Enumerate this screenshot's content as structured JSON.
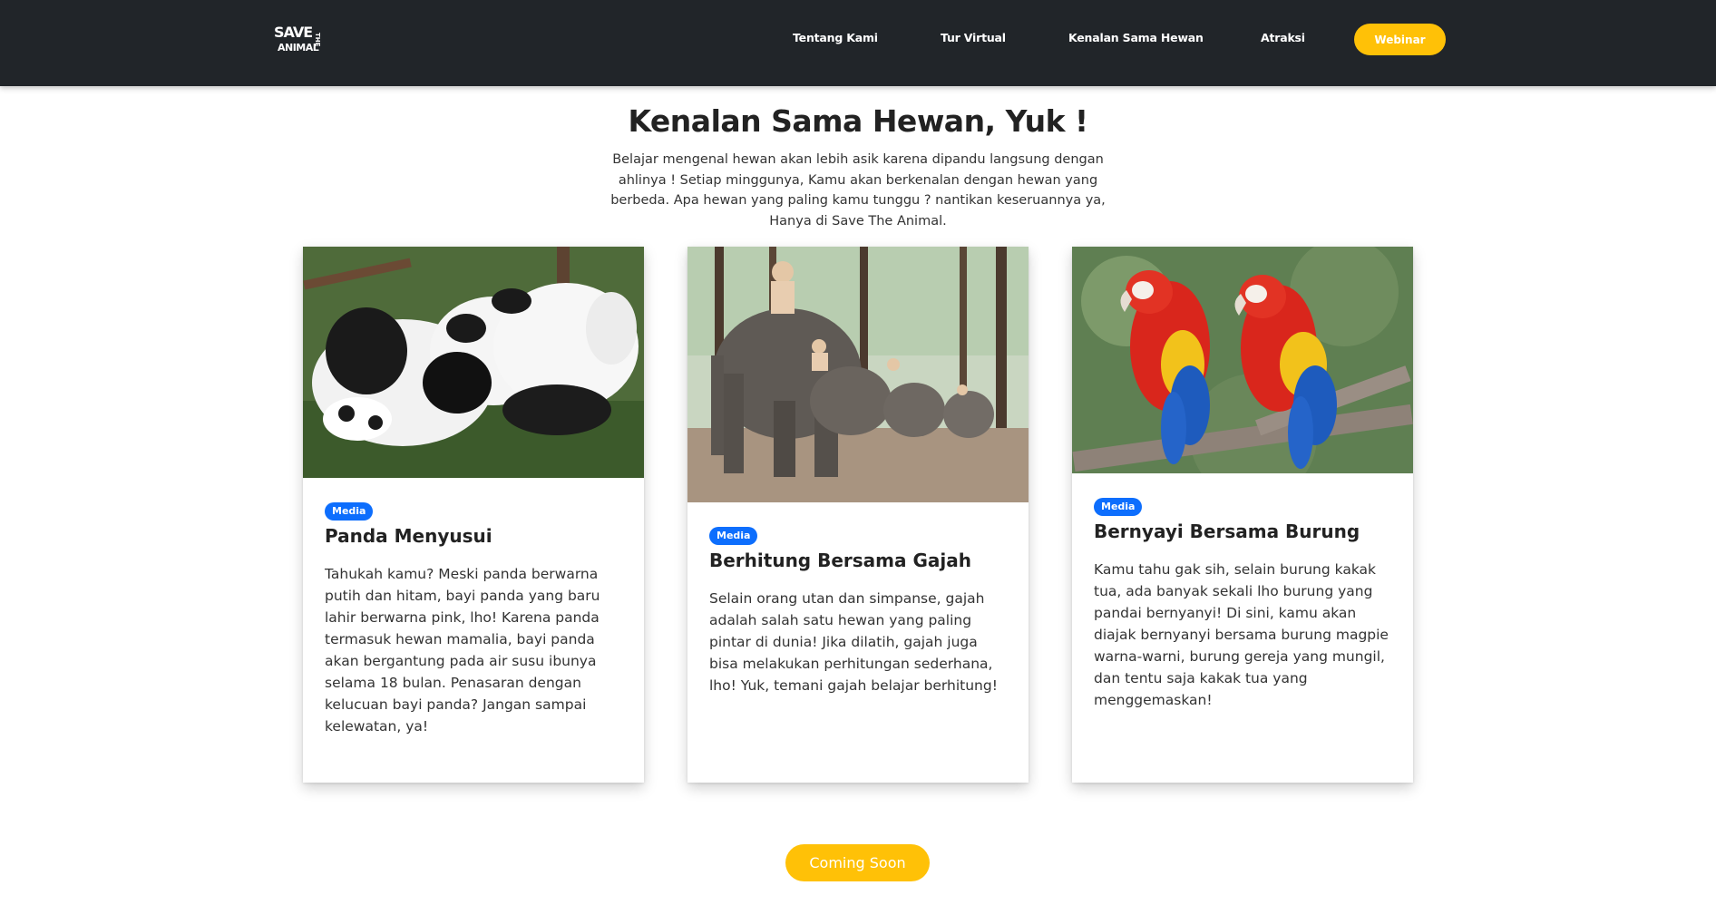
{
  "nav": {
    "logo_line1": "SAVE",
    "logo_line2": "THE",
    "logo_line3": "ANIMAL",
    "links": [
      "Tentang Kami",
      "Tur Virtual",
      "Kenalan Sama Hewan",
      "Atraksi"
    ],
    "webinar": "Webinar"
  },
  "hero": {
    "title": "Kenalan Sama Hewan, Yuk !",
    "intro": "Belajar mengenal hewan akan lebih asik karena dipandu langsung dengan ahlinya ! Setiap minggunya, Kamu akan berkenalan dengan hewan yang berbeda. Apa hewan yang paling kamu tunggu ? nantikan keseruannya ya, Hanya di Save The Animal."
  },
  "cards": [
    {
      "badge": "Media",
      "title": "Panda Menyusui",
      "text": "Tahukah kamu? Meski panda berwarna putih dan hitam, bayi panda yang baru lahir berwarna pink, lho! Karena panda termasuk hewan mamalia, bayi panda akan bergantung pada air susu ibunya selama 18 bulan. Penasaran dengan kelucuan bayi panda? Jangan sampai kelewatan, ya!"
    },
    {
      "badge": "Media",
      "title": "Berhitung Bersama Gajah",
      "text": "Selain orang utan dan simpanse, gajah adalah salah satu hewan yang paling pintar di dunia! Jika dilatih, gajah juga bisa melakukan perhitungan sederhana, lho! Yuk, temani gajah belajar berhitung!"
    },
    {
      "badge": "Media",
      "title": "Bernyayi Bersama Burung",
      "text": "Kamu tahu gak sih, selain burung kakak tua, ada banyak sekali lho burung yang pandai bernyanyi! Di sini, kamu akan diajak bernyanyi bersama burung magpie warna-warni, burung gereja yang mungil, dan tentu saja kakak tua yang menggemaskan!"
    }
  ],
  "coming_soon": "Coming Soon",
  "colors": {
    "navbar": "#212529",
    "accent": "#ffc107",
    "badge": "#0d6efd"
  }
}
